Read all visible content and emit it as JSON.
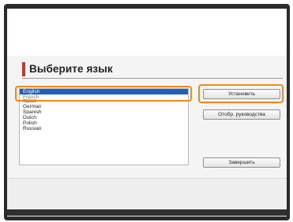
{
  "dialog": {
    "title": "Выберите язык",
    "languages": [
      {
        "label": "English",
        "selected": true
      },
      {
        "label": "French",
        "selected": false
      },
      {
        "label": "Italian",
        "selected": false
      },
      {
        "label": "German",
        "selected": false
      },
      {
        "label": "Spanish",
        "selected": false
      },
      {
        "label": "Dutch",
        "selected": false
      },
      {
        "label": "Polish",
        "selected": false
      },
      {
        "label": "Russian",
        "selected": false
      }
    ],
    "install_label": "Установить",
    "show_manual_label": "Отобр. руководства",
    "exit_label": "Завершить"
  },
  "colors": {
    "accent_bar": "#c0392b",
    "highlight": "#ef8a1f",
    "selection": "#1c5fbf"
  }
}
